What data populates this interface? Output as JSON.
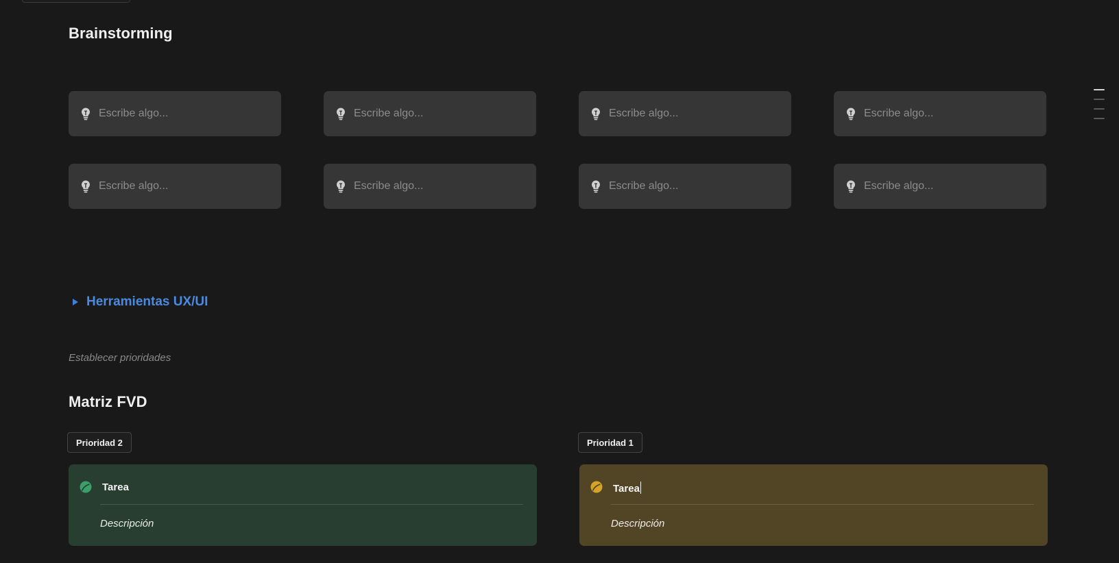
{
  "brainstorming": {
    "title": "Brainstorming",
    "ideas": [
      {
        "placeholder": "Escribe algo..."
      },
      {
        "placeholder": "Escribe algo..."
      },
      {
        "placeholder": "Escribe algo..."
      },
      {
        "placeholder": "Escribe algo..."
      },
      {
        "placeholder": "Escribe algo..."
      },
      {
        "placeholder": "Escribe algo..."
      },
      {
        "placeholder": "Escribe algo..."
      },
      {
        "placeholder": "Escribe algo..."
      }
    ],
    "icon": "lightbulb-icon"
  },
  "toggle": {
    "label": "Herramientas UX/UI"
  },
  "hint": "Establecer prioridades",
  "matrix": {
    "title": "Matriz FVD",
    "columns": [
      {
        "badge": "Prioridad 2",
        "task_title": "Tarea",
        "task_desc": "Descripción",
        "color": "#273e30",
        "icon_color": "#3aa06a"
      },
      {
        "badge": "Prioridad 1",
        "task_title": "Tarea",
        "task_desc": "Descripción",
        "color": "#524525",
        "icon_color": "#d6a22a"
      }
    ]
  },
  "colors": {
    "background": "#191919",
    "card": "#363636",
    "link": "#4a8ae0"
  }
}
